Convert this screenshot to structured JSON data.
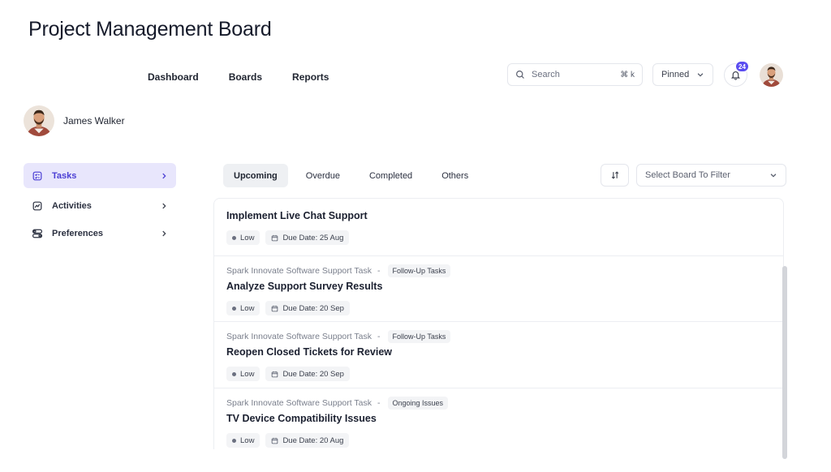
{
  "app": {
    "title": "Project Management Board"
  },
  "nav": {
    "items": [
      "Dashboard",
      "Boards",
      "Reports"
    ]
  },
  "header": {
    "search_placeholder": "Search",
    "search_shortcut": "⌘ k",
    "pinned_label": "Pinned",
    "notification_count": "24"
  },
  "profile": {
    "name": "James Walker"
  },
  "sidebar": {
    "items": [
      {
        "label": "Tasks",
        "icon": "tasks-icon",
        "active": true
      },
      {
        "label": "Activities",
        "icon": "activity-chart-icon",
        "active": false
      },
      {
        "label": "Preferences",
        "icon": "toggles-icon",
        "active": false
      }
    ]
  },
  "tabs": {
    "items": [
      "Upcoming",
      "Overdue",
      "Completed",
      "Others"
    ],
    "active": "Upcoming"
  },
  "filter": {
    "placeholder": "Select Board To Filter"
  },
  "tasks": [
    {
      "project": "",
      "category": "",
      "title": "Implement Live Chat Support",
      "priority": "Low",
      "due": "Due Date: 25 Aug"
    },
    {
      "project": "Spark Innovate Software Support Task",
      "category": "Follow-Up Tasks",
      "title": "Analyze Support Survey Results",
      "priority": "Low",
      "due": "Due Date: 20 Sep"
    },
    {
      "project": "Spark Innovate Software Support Task",
      "category": "Follow-Up Tasks",
      "title": "Reopen Closed Tickets for Review",
      "priority": "Low",
      "due": "Due Date: 20 Sep"
    },
    {
      "project": "Spark Innovate Software Support Task",
      "category": "Ongoing Issues",
      "title": "TV Device Compatibility Issues",
      "priority": "Low",
      "due": "Due Date: 20 Aug"
    }
  ],
  "colors": {
    "accent": "#5b4df0",
    "active_bg": "#e8e6fc",
    "active_text": "#4b3fd4"
  }
}
